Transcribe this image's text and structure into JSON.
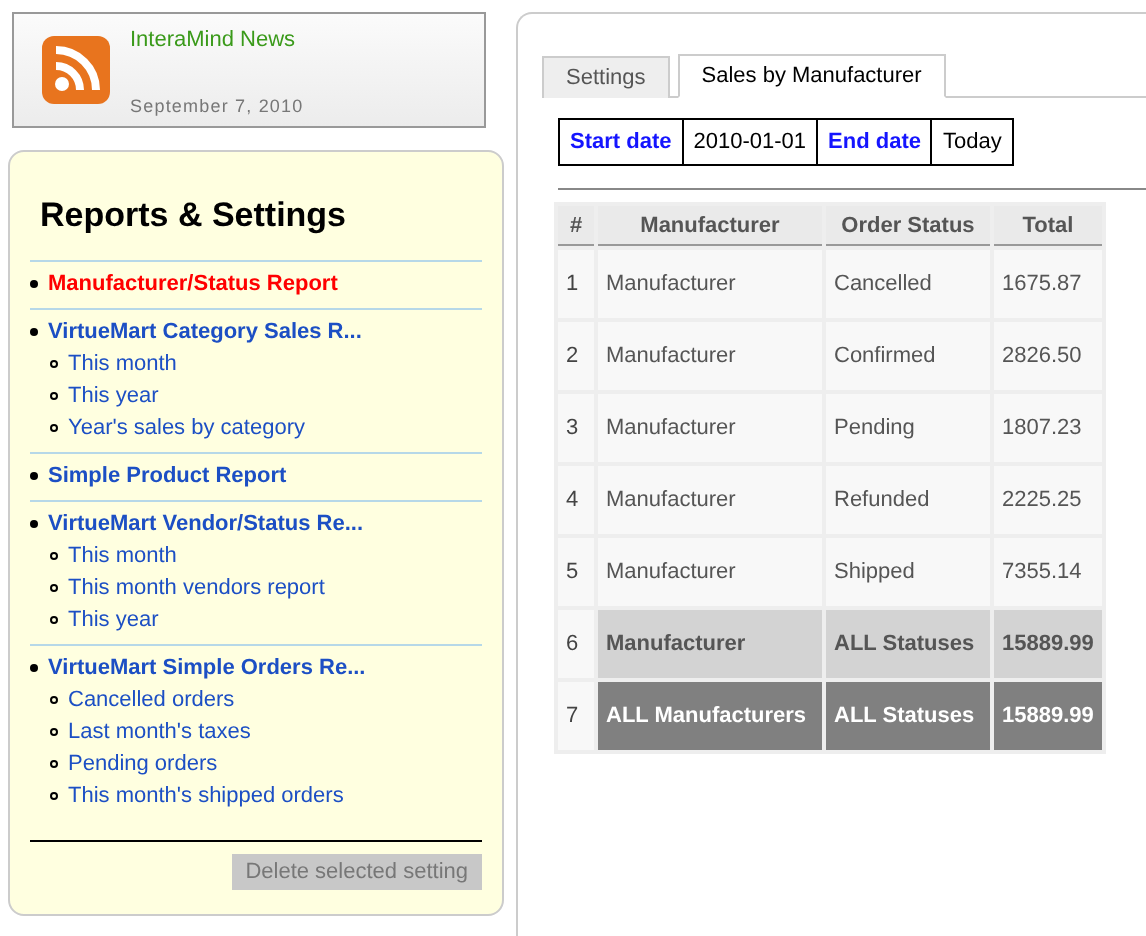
{
  "news": {
    "title": "InteraMind News",
    "date": "September 7, 2010"
  },
  "reports": {
    "title": "Reports & Settings",
    "groups": [
      {
        "label": "Manufacturer/Status Report",
        "selected": true
      },
      {
        "label": "VirtueMart Category Sales R...",
        "selected": false,
        "children": [
          {
            "label": "This month"
          },
          {
            "label": "This year"
          },
          {
            "label": "Year's sales by category"
          }
        ]
      },
      {
        "label": "Simple Product Report",
        "selected": false
      },
      {
        "label": "VirtueMart Vendor/Status Re...",
        "selected": false,
        "children": [
          {
            "label": "This month"
          },
          {
            "label": "This month vendors report"
          },
          {
            "label": "This year"
          }
        ]
      },
      {
        "label": "VirtueMart Simple Orders Re...",
        "selected": false,
        "children": [
          {
            "label": "Cancelled orders"
          },
          {
            "label": "Last month's taxes"
          },
          {
            "label": "Pending orders"
          },
          {
            "label": "This month's shipped orders"
          }
        ]
      }
    ],
    "delete_button": {
      "label": "Delete selected setting",
      "disabled": true
    }
  },
  "tabs": [
    {
      "label": "Settings",
      "selected": false
    },
    {
      "label": "Sales by Manufacturer",
      "selected": true
    }
  ],
  "date_range": {
    "start_label": "Start date",
    "start_value": "2010-01-01",
    "end_label": "End date",
    "end_value": "Today"
  },
  "table": {
    "columns": [
      "#",
      "Manufacturer",
      "Order Status",
      "Total"
    ],
    "rows": [
      {
        "kind": "detail",
        "cells": [
          "1",
          "Manufacturer",
          "Cancelled",
          "1675.87"
        ]
      },
      {
        "kind": "detail",
        "cells": [
          "2",
          "Manufacturer",
          "Confirmed",
          "2826.50"
        ]
      },
      {
        "kind": "detail",
        "cells": [
          "3",
          "Manufacturer",
          "Pending",
          "1807.23"
        ]
      },
      {
        "kind": "detail",
        "cells": [
          "4",
          "Manufacturer",
          "Refunded",
          "2225.25"
        ]
      },
      {
        "kind": "detail",
        "cells": [
          "5",
          "Manufacturer",
          "Shipped",
          "7355.14"
        ]
      },
      {
        "kind": "subtotal",
        "cells": [
          "6",
          "Manufacturer",
          "ALL Statuses",
          "15889.99"
        ]
      },
      {
        "kind": "total",
        "cells": [
          "7",
          "ALL Manufacturers",
          "ALL Statuses",
          "15889.99"
        ]
      }
    ]
  }
}
